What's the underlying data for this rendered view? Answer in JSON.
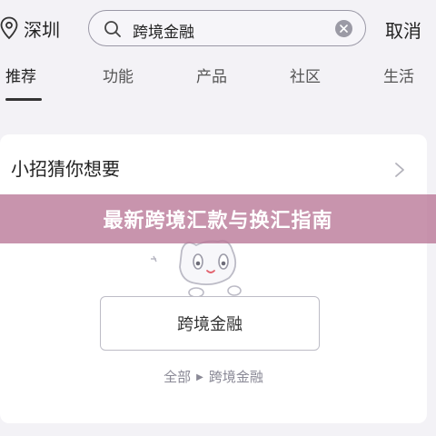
{
  "location": {
    "city": "深圳",
    "icon": "location-pin-icon"
  },
  "search": {
    "query": "跨境金融",
    "search_icon": "search-icon",
    "clear_icon": "clear-icon"
  },
  "header": {
    "cancel_label": "取消"
  },
  "tabs": [
    {
      "label": "推荐",
      "active": true
    },
    {
      "label": "功能",
      "active": false
    },
    {
      "label": "产品",
      "active": false
    },
    {
      "label": "社区",
      "active": false
    },
    {
      "label": "生活",
      "active": false
    }
  ],
  "card": {
    "title": "小招猜你想要",
    "chevron_icon": "chevron-right-icon",
    "mascot_icon": "cat-mascot-icon",
    "button_label": "跨境金融",
    "path": {
      "root": "全部",
      "leaf": "跨境金融"
    }
  },
  "banner": {
    "text": "最新跨境汇款与换汇指南"
  },
  "colors": {
    "banner": "#b87696",
    "background": "#f3f2f6",
    "card": "#ffffff"
  }
}
